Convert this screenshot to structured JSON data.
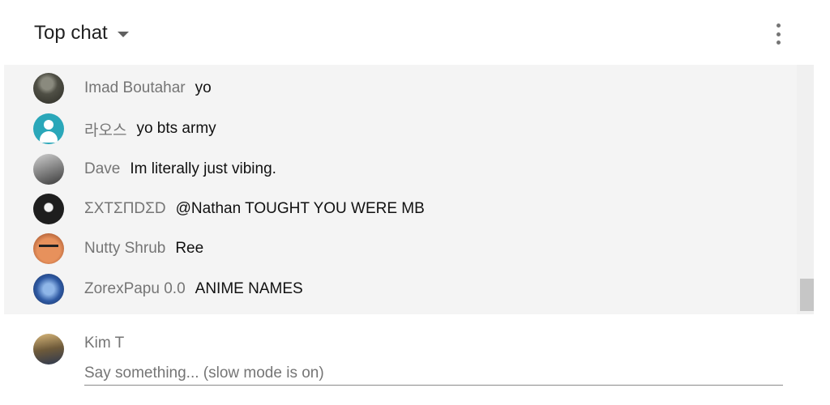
{
  "header": {
    "title": "Top chat",
    "dropdown_icon": "caret-down-icon",
    "more_icon": "more-vertical-icon"
  },
  "messages": [
    {
      "author": "Imad Boutahar",
      "text": "yo",
      "avatar": "user-photo-avatar"
    },
    {
      "author": "라오스",
      "text": "yo bts army",
      "avatar": "default-person-avatar"
    },
    {
      "author": "Dave",
      "text": "Im literally just vibing.",
      "avatar": "user-photo-avatar"
    },
    {
      "author": "ΣXTΣПDΣD",
      "text": "@Nathan TOUGHT YOU WERE MB",
      "avatar": "user-photo-avatar"
    },
    {
      "author": "Nutty Shrub",
      "text": "Ree",
      "avatar": "user-photo-avatar"
    },
    {
      "author": "ZorexPapu 0.0",
      "text": "ANIME NAMES",
      "avatar": "user-photo-avatar"
    }
  ],
  "composer": {
    "user_name": "Kim T",
    "placeholder": "Say something... (slow mode is on)",
    "value": ""
  },
  "colors": {
    "chat_background": "#f4f4f4",
    "author_text": "#757575",
    "message_text": "#111111",
    "default_avatar": "#2aa7b9"
  }
}
